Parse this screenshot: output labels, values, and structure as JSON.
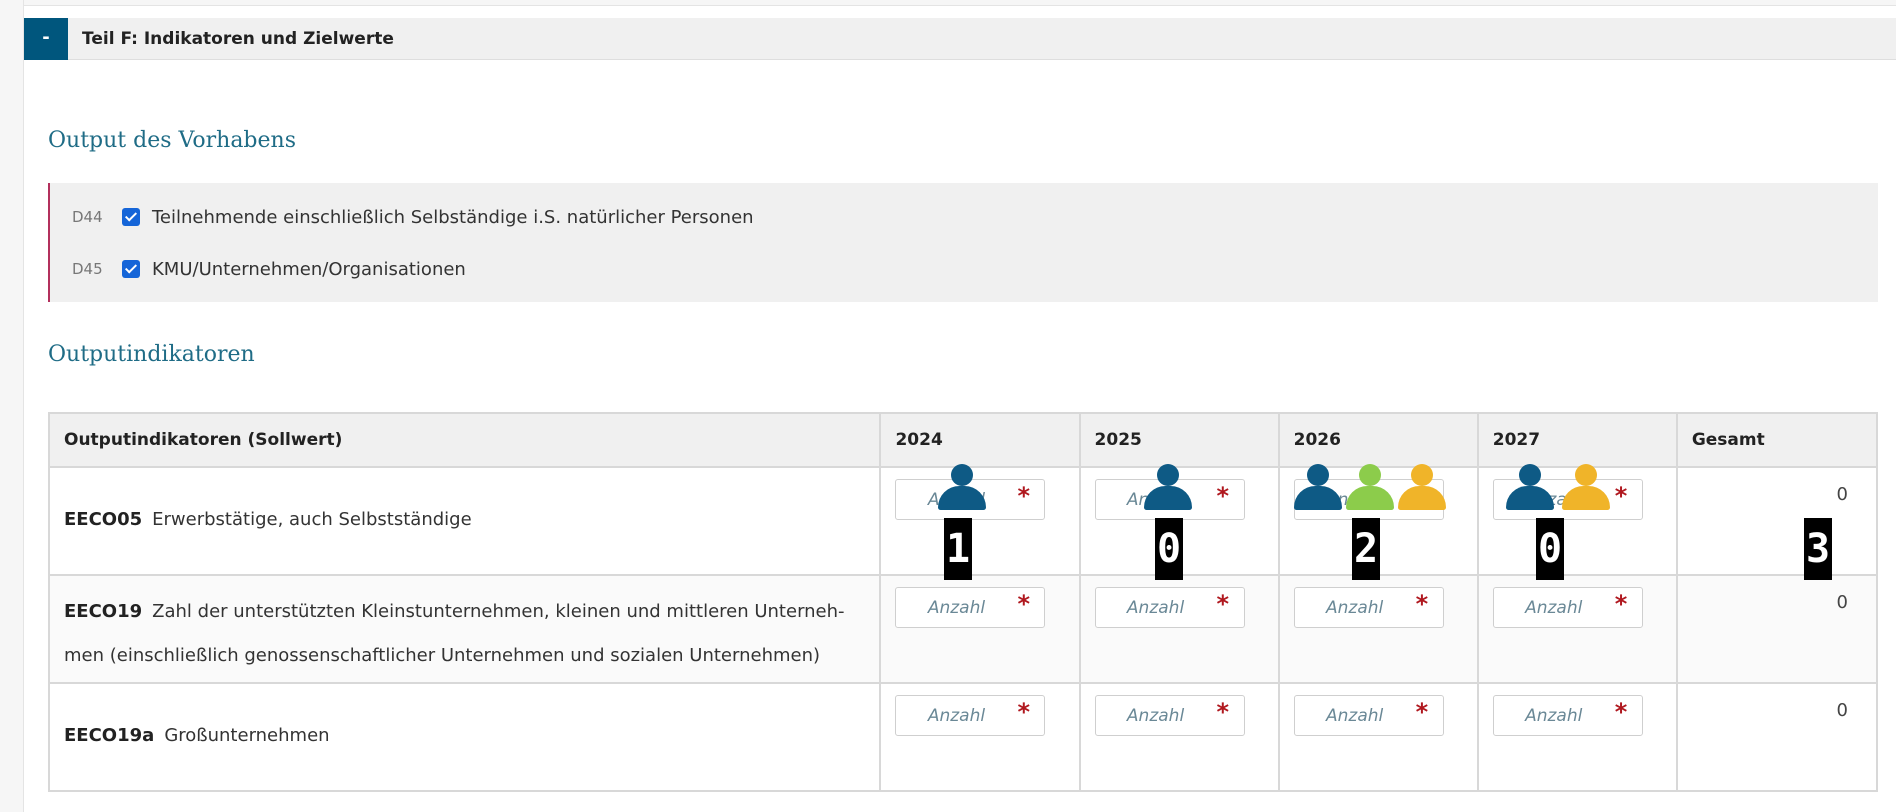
{
  "section": {
    "toggle_label": "-",
    "title": "Teil F: Indikatoren und Zielwerte"
  },
  "output": {
    "heading": "Output des Vorhabens",
    "items": [
      {
        "code": "D44",
        "checked": true,
        "label": "Teilnehmende einschließlich Selbständige i.S. natürlicher Personen"
      },
      {
        "code": "D45",
        "checked": true,
        "label": "KMU/Unternehmen/Organisationen"
      }
    ]
  },
  "indicators": {
    "heading": "Outputindikatoren",
    "headers": [
      "Outputindikatoren (Sollwert)",
      "2024",
      "2025",
      "2026",
      "2027",
      "Gesamt"
    ],
    "input_placeholder": "Anzahl",
    "required_mark": "*",
    "rows": [
      {
        "code": "EECO05",
        "label": "Erwerbstätige, auch Selbstständige",
        "total": "0"
      },
      {
        "code": "EECO19",
        "label": "Zahl der unterstützten Kleinstunternehmen, kleinen und mittleren Unterneh- men (einschließlich genossenschaftlicher Unternehmen und sozialen Unternehmen)",
        "total": "0"
      },
      {
        "code": "EECO19a",
        "label": "Großunternehmen",
        "total": "0"
      }
    ]
  },
  "overlay": {
    "colors": {
      "blue": "#0e5a85",
      "green": "#8ccc4b",
      "yellow": "#f0b429"
    },
    "badges": [
      "1",
      "0",
      "2",
      "0",
      "3"
    ]
  }
}
